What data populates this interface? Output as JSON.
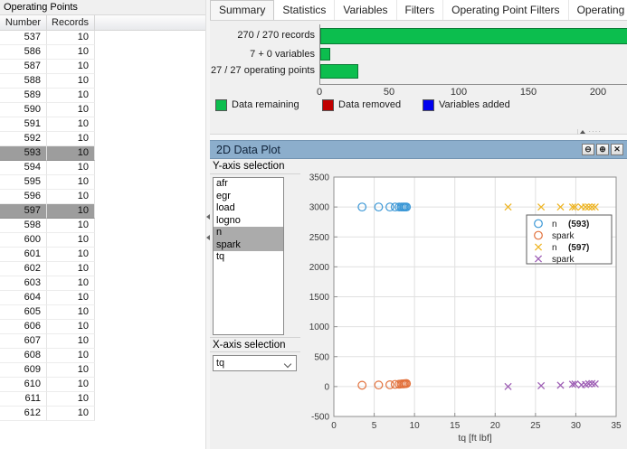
{
  "left_panel": {
    "title": "Operating Points",
    "columns": [
      "Number",
      "Records"
    ],
    "rows": [
      [
        537,
        10
      ],
      [
        586,
        10
      ],
      [
        587,
        10
      ],
      [
        588,
        10
      ],
      [
        589,
        10
      ],
      [
        590,
        10
      ],
      [
        591,
        10
      ],
      [
        592,
        10
      ],
      [
        593,
        10
      ],
      [
        594,
        10
      ],
      [
        595,
        10
      ],
      [
        596,
        10
      ],
      [
        597,
        10
      ],
      [
        598,
        10
      ],
      [
        600,
        10
      ],
      [
        601,
        10
      ],
      [
        602,
        10
      ],
      [
        603,
        10
      ],
      [
        604,
        10
      ],
      [
        605,
        10
      ],
      [
        606,
        10
      ],
      [
        607,
        10
      ],
      [
        608,
        10
      ],
      [
        609,
        10
      ],
      [
        610,
        10
      ],
      [
        611,
        10
      ],
      [
        612,
        10
      ]
    ],
    "selected_numbers": [
      593,
      597
    ]
  },
  "tabs": [
    "Summary",
    "Statistics",
    "Variables",
    "Filters",
    "Operating Point Filters",
    "Operating Point Notes"
  ],
  "active_tab": "Summary",
  "plot_panel": {
    "title": "2D Data Plot",
    "window_buttons": [
      {
        "name": "rollup-button",
        "glyph": "⊖"
      },
      {
        "name": "dock-button",
        "glyph": "⊕"
      },
      {
        "name": "close-button",
        "glyph": "✕"
      }
    ],
    "y_axis_label": "Y-axis selection",
    "y_axis_items": [
      "afr",
      "egr",
      "load",
      "logno",
      "n",
      "spark",
      "tq"
    ],
    "y_axis_selected": [
      "n",
      "spark"
    ],
    "x_axis_label": "X-axis selection",
    "x_axis_value": "tq"
  },
  "chart_data": [
    {
      "type": "bar",
      "orientation": "horizontal",
      "categories": [
        "270 / 270 records",
        "7 + 0 variables",
        "27 / 27 operating points"
      ],
      "values": [
        270,
        7,
        27
      ],
      "xlim": [
        0,
        220
      ],
      "xticks": [
        0,
        50,
        100,
        150,
        200
      ],
      "bar_color": "#0cbe4e",
      "legend": [
        {
          "label": "Data remaining",
          "color": "#0cbe4e"
        },
        {
          "label": "Data removed",
          "color": "#c00000"
        },
        {
          "label": "Variables added",
          "color": "#0000ee"
        }
      ]
    },
    {
      "type": "scatter",
      "xlabel": "tq [ft lbf]",
      "xlim": [
        0,
        35
      ],
      "ylim": [
        -500,
        3500
      ],
      "xticks": [
        0,
        5,
        10,
        15,
        20,
        25,
        30,
        35
      ],
      "yticks": [
        -500,
        0,
        500,
        1000,
        1500,
        2000,
        2500,
        3000,
        3500
      ],
      "grid": true,
      "legend_position": "right-middle",
      "series": [
        {
          "name": "n",
          "tag": "(593)",
          "marker": "circle",
          "color": "#3a97d6",
          "x": [
            3.5,
            5.55,
            6.95,
            7.6,
            8.1,
            8.35,
            8.55,
            8.7,
            8.85,
            9.0
          ],
          "y": [
            3000,
            3000,
            3000,
            3000,
            3000,
            3000,
            3000,
            3000,
            3000,
            3000
          ]
        },
        {
          "name": "spark",
          "tag": "",
          "marker": "circle",
          "color": "#e2713c",
          "x": [
            3.5,
            5.55,
            6.95,
            7.6,
            8.1,
            8.35,
            8.55,
            8.7,
            8.85,
            9.0
          ],
          "y": [
            22,
            26,
            30,
            36,
            40,
            43,
            45,
            46,
            48,
            50
          ]
        },
        {
          "name": "n",
          "tag": "(597)",
          "marker": "x",
          "color": "#eeb525",
          "x": [
            21.6,
            25.7,
            28.1,
            29.6,
            29.9,
            30.7,
            31.2,
            31.6,
            32.0,
            32.4
          ],
          "y": [
            3000,
            3000,
            3000,
            3000,
            3000,
            3000,
            3000,
            3000,
            3000,
            3000
          ]
        },
        {
          "name": "spark",
          "tag": "",
          "marker": "x",
          "color": "#9e5fb5",
          "x": [
            21.6,
            25.7,
            28.1,
            29.6,
            29.9,
            30.7,
            31.2,
            31.6,
            32.0,
            32.4
          ],
          "y": [
            0,
            14,
            22,
            38,
            42,
            28,
            34,
            46,
            50,
            44
          ]
        }
      ]
    }
  ]
}
